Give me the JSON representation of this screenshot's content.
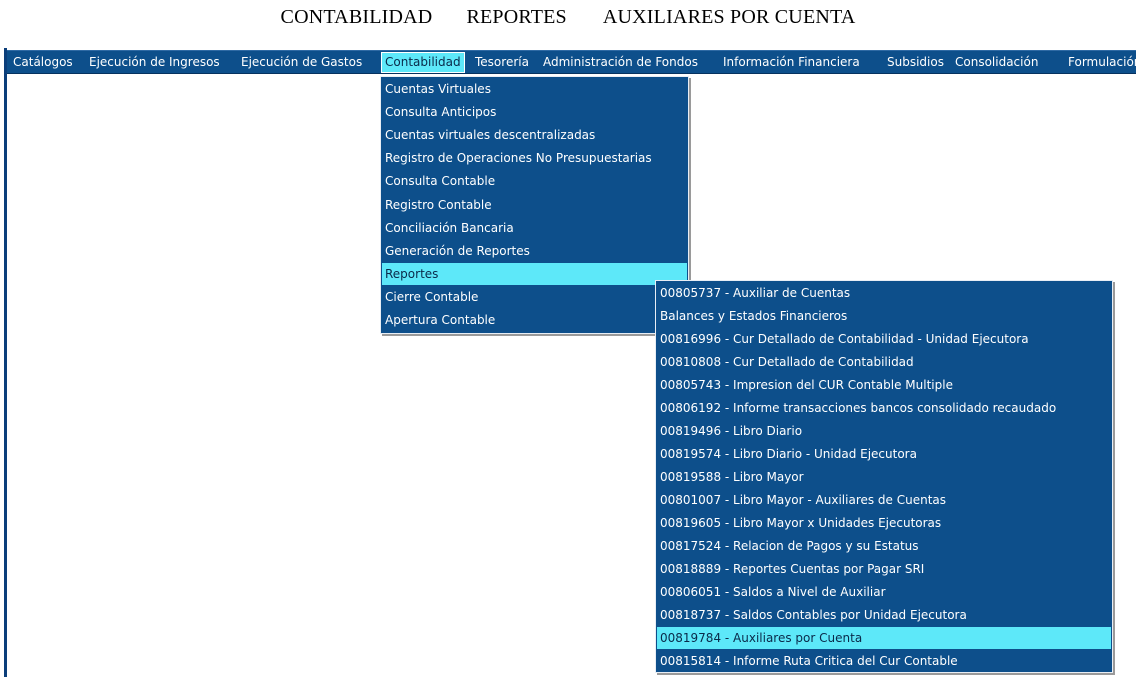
{
  "breadcrumb": {
    "part1": "CONTABILIDAD",
    "part2": "REPORTES",
    "part3": "AUXILIARES POR CUENTA"
  },
  "colors": {
    "menu_bg": "#0d4f8b",
    "highlight": "#5de8f9",
    "menu_text": "#ffffff",
    "highlight_text": "#0a2a4a"
  },
  "menubar": {
    "items": [
      "Catálogos",
      "Ejecución de Ingresos",
      "Ejecución de Gastos",
      "Contabilidad",
      "Tesorería",
      "Administración de Fondos",
      "Información Financiera",
      "Subsidios",
      "Consolidación",
      "Formulación"
    ],
    "active_item": "Contabilidad"
  },
  "contabilidad_menu": {
    "items": [
      "Cuentas Virtuales",
      "Consulta Anticipos",
      "Cuentas virtuales descentralizadas",
      "Registro de Operaciones No Presupuestarias",
      "Consulta Contable",
      "Registro Contable",
      "Conciliación Bancaria",
      "Generación de Reportes",
      "Reportes",
      "Cierre Contable",
      "Apertura Contable"
    ],
    "active_item": "Reportes"
  },
  "reportes_menu": {
    "items": [
      "00805737 - Auxiliar de Cuentas",
      "Balances y Estados Financieros",
      "00816996 - Cur Detallado de Contabilidad - Unidad Ejecutora",
      "00810808 - Cur Detallado de Contabilidad",
      "00805743 - Impresion del CUR Contable Multiple",
      "00806192 - Informe transacciones bancos consolidado recaudado",
      "00819496 - Libro Diario",
      "00819574 - Libro Diario - Unidad Ejecutora",
      "00819588 - Libro Mayor",
      "00801007 - Libro Mayor - Auxiliares de Cuentas",
      "00819605 - Libro Mayor x Unidades Ejecutoras",
      "00817524 - Relacion de Pagos y su Estatus",
      "00818889 - Reportes Cuentas por Pagar SRI",
      "00806051 - Saldos a Nivel de Auxiliar",
      "00818737 - Saldos Contables por Unidad Ejecutora",
      "00819784 - Auxiliares por Cuenta",
      "00815814 - Informe Ruta Critica del Cur Contable"
    ],
    "active_item": "00819784 - Auxiliares por Cuenta"
  }
}
